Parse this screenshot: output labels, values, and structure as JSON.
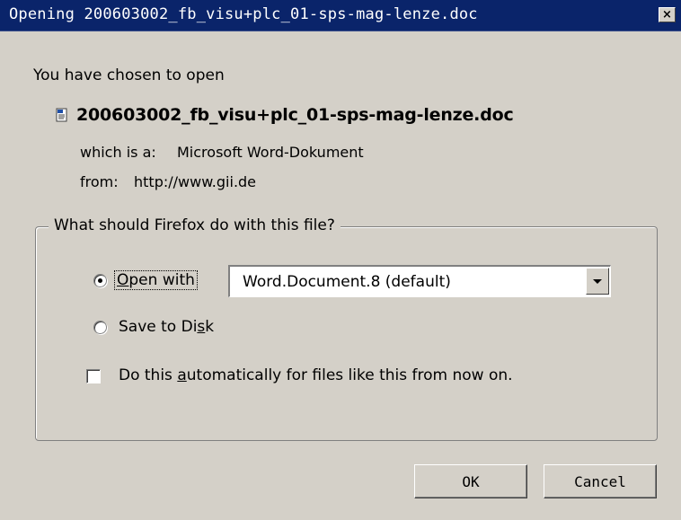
{
  "window": {
    "title": "Opening 200603002_fb_visu+plc_01-sps-mag-lenze.doc",
    "close_glyph": "×"
  },
  "dialog": {
    "intro": "You have chosen to open",
    "file_icon": "word-document-icon",
    "filename": "200603002_fb_visu+plc_01-sps-mag-lenze.doc",
    "type_label": "which is a:",
    "type_value": "Microsoft Word-Dokument",
    "from_label": "from:",
    "from_value": "http://www.gii.de"
  },
  "action_group": {
    "legend": "What should Firefox do with this file?",
    "open_with": {
      "label_pre": "",
      "mnemonic": "O",
      "label_post": "pen with",
      "selected": true
    },
    "application": "Word.Document.8 (default)",
    "save_to_disk": {
      "label_pre": "Save to Di",
      "mnemonic": "s",
      "label_post": "k",
      "selected": false
    },
    "auto": {
      "label_pre": "Do this ",
      "mnemonic": "a",
      "label_post": "utomatically for files like this from now on.",
      "checked": false
    }
  },
  "buttons": {
    "ok": "OK",
    "cancel": "Cancel"
  },
  "colors": {
    "titlebar": "#0a246a",
    "face": "#d4d0c8"
  }
}
